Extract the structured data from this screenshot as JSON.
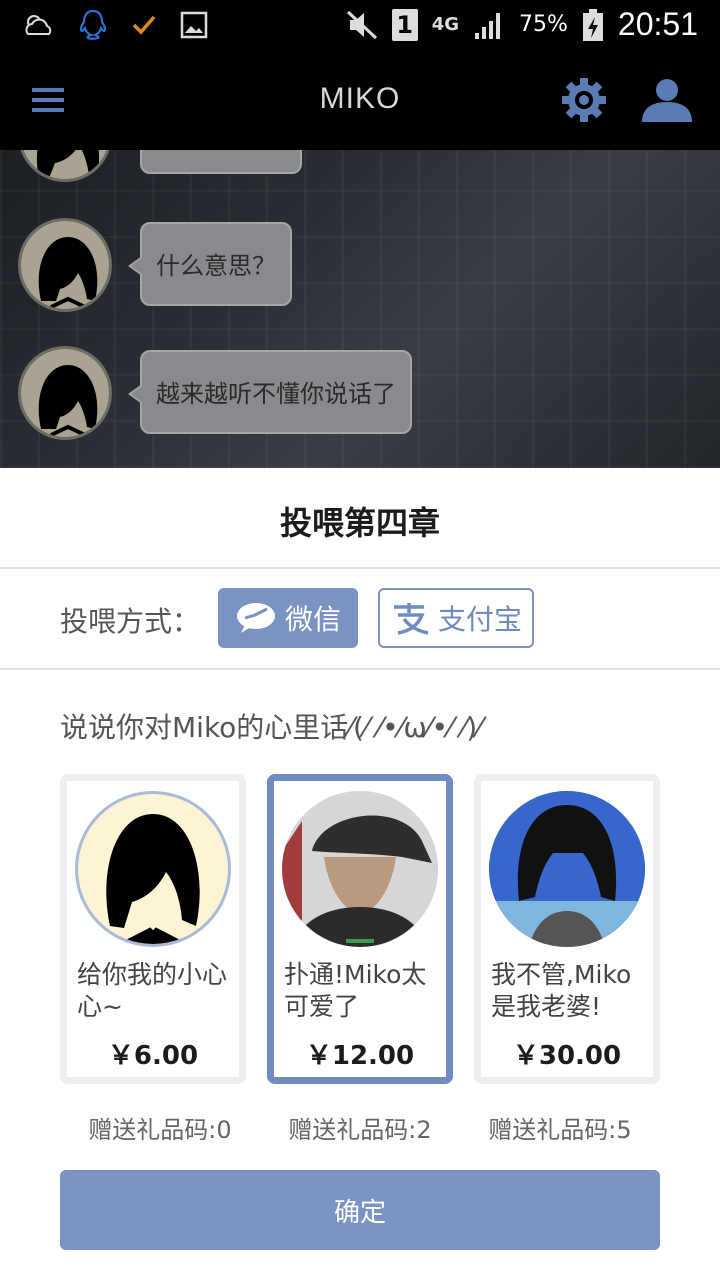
{
  "status_bar": {
    "battery_percent": "75%",
    "time": "20:51",
    "network": "4G",
    "sim": "1",
    "icons": [
      "cloudy-weather-icon",
      "qq-icon",
      "check-icon",
      "gallery-icon",
      "mute-icon",
      "sim-icon",
      "network-icon",
      "signal-icon",
      "battery-charging-icon"
    ]
  },
  "app_bar": {
    "title": "MIKO",
    "icons": [
      "menu-icon",
      "gear-icon",
      "user-icon"
    ]
  },
  "chat": {
    "messages": [
      {
        "text": "什么意思？"
      },
      {
        "text": "越来越听不懂你说话了"
      }
    ]
  },
  "sheet": {
    "title": "投喂第四章",
    "payment_label": "投喂方式：",
    "payment_options": [
      {
        "label": "微信",
        "selected": true,
        "icon": "wechat-icon"
      },
      {
        "label": "支付宝",
        "selected": false,
        "icon": "alipay-icon"
      }
    ],
    "prompt": "说说你对Miko的心里话⁄(⁄ ⁄•⁄ω⁄•⁄ ⁄)⁄",
    "gifts": [
      {
        "desc": "给你我的小心心~",
        "price": "￥6.00",
        "gift_code": "赠送礼品码:0",
        "selected": false
      },
      {
        "desc": "扑通!Miko太可爱了",
        "price": "￥12.00",
        "gift_code": "赠送礼品码:2",
        "selected": true
      },
      {
        "desc": "我不管,Miko是我老婆!",
        "price": "￥30.00",
        "gift_code": "赠送礼品码:5",
        "selected": false
      }
    ],
    "confirm_label": "确定"
  },
  "colors": {
    "accent": "#7a93c3",
    "appbar_bg": "#000000",
    "bubble_bg": "#888a8d"
  }
}
